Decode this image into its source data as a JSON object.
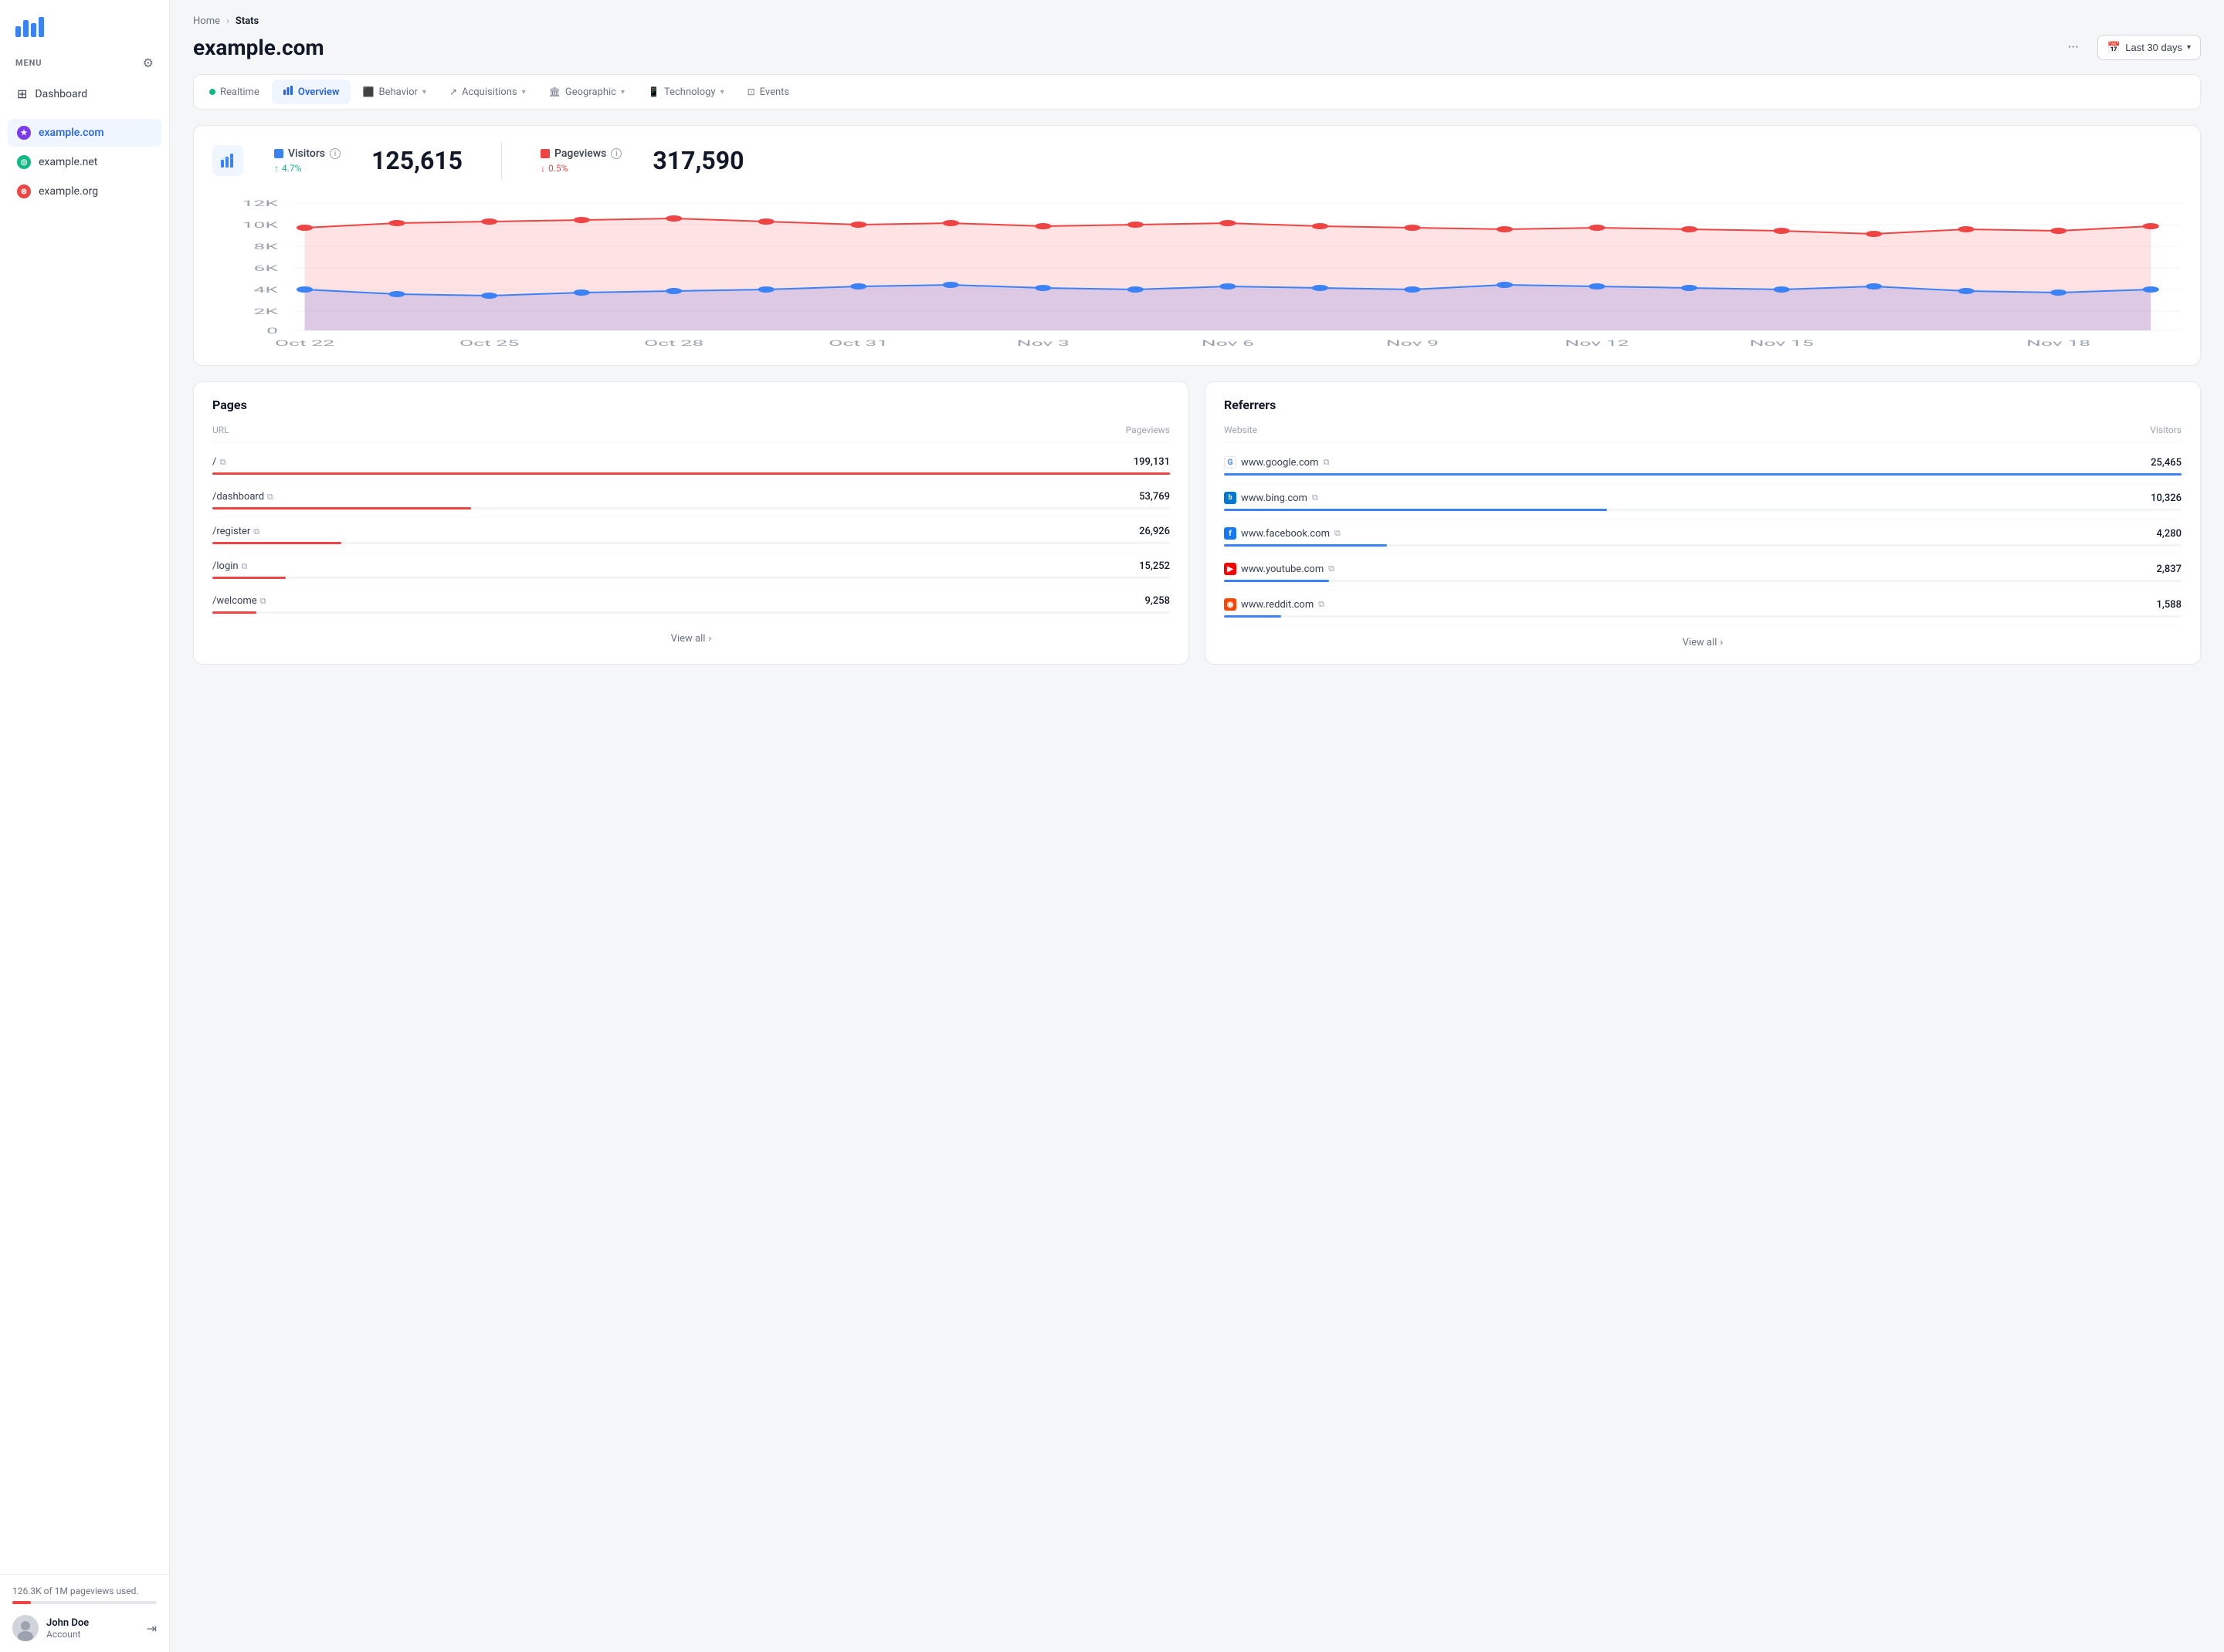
{
  "sidebar": {
    "menu_label": "MENU",
    "nav_items": [
      {
        "id": "dashboard",
        "label": "Dashboard",
        "icon": "grid"
      }
    ],
    "sites": [
      {
        "id": "example-com",
        "label": "example.com",
        "icon": "★",
        "color": "purple",
        "active": true
      },
      {
        "id": "example-net",
        "label": "example.net",
        "icon": "◎",
        "color": "green",
        "active": false
      },
      {
        "id": "example-org",
        "label": "example.org",
        "icon": "⊗",
        "color": "red",
        "active": false
      }
    ],
    "usage_text": "126.3K of 1M pageviews used.",
    "user": {
      "name": "John Doe",
      "role": "Account"
    }
  },
  "breadcrumb": {
    "home": "Home",
    "current": "Stats"
  },
  "page": {
    "title": "example.com",
    "date_range": "Last 30 days",
    "more_icon": "···"
  },
  "tabs": [
    {
      "id": "realtime",
      "label": "Realtime",
      "type": "dot"
    },
    {
      "id": "overview",
      "label": "Overview",
      "type": "icon",
      "icon": "📊",
      "active": true
    },
    {
      "id": "behavior",
      "label": "Behavior",
      "type": "icon",
      "icon": "⬜",
      "dropdown": true
    },
    {
      "id": "acquisitions",
      "label": "Acquisitions",
      "type": "icon",
      "icon": "↗",
      "dropdown": true
    },
    {
      "id": "geographic",
      "label": "Geographic",
      "type": "icon",
      "icon": "🏛",
      "dropdown": true
    },
    {
      "id": "technology",
      "label": "Technology",
      "type": "icon",
      "icon": "📱",
      "dropdown": true
    },
    {
      "id": "events",
      "label": "Events",
      "type": "icon",
      "icon": "◻"
    }
  ],
  "stats": {
    "visitors_label": "Visitors",
    "visitors_change": "4.7%",
    "visitors_change_dir": "up",
    "visitors_value": "125,615",
    "pageviews_label": "Pageviews",
    "pageviews_change": "0.5%",
    "pageviews_change_dir": "down",
    "pageviews_value": "317,590"
  },
  "chart": {
    "y_labels": [
      "12K",
      "10K",
      "8K",
      "6K",
      "4K",
      "2K",
      "0"
    ],
    "x_labels": [
      "Oct 22",
      "Oct 25",
      "Oct 28",
      "Oct 31",
      "Nov 3",
      "Nov 6",
      "Nov 9",
      "Nov 12",
      "Nov 15",
      "Nov 18"
    ]
  },
  "pages_table": {
    "title": "Pages",
    "col_url": "URL",
    "col_pageviews": "Pageviews",
    "rows": [
      {
        "url": "/",
        "value": "199,131",
        "pct": 100
      },
      {
        "url": "/dashboard",
        "value": "53,769",
        "pct": 27
      },
      {
        "url": "/register",
        "value": "26,926",
        "pct": 13.5
      },
      {
        "url": "/login",
        "value": "15,252",
        "pct": 7.7
      },
      {
        "url": "/welcome",
        "value": "9,258",
        "pct": 4.6
      }
    ],
    "view_all": "View all"
  },
  "referrers_table": {
    "title": "Referrers",
    "col_website": "Website",
    "col_visitors": "Visitors",
    "rows": [
      {
        "site": "www.google.com",
        "favicon": "G",
        "color": "google",
        "value": "25,465",
        "pct": 100
      },
      {
        "site": "www.bing.com",
        "favicon": "b",
        "color": "bing",
        "value": "10,326",
        "pct": 40
      },
      {
        "site": "www.facebook.com",
        "favicon": "f",
        "color": "facebook",
        "value": "4,280",
        "pct": 17
      },
      {
        "site": "www.youtube.com",
        "favicon": "▶",
        "color": "youtube",
        "value": "2,837",
        "pct": 11
      },
      {
        "site": "www.reddit.com",
        "favicon": "◉",
        "color": "reddit",
        "value": "1,588",
        "pct": 6
      }
    ],
    "view_all": "View all"
  }
}
